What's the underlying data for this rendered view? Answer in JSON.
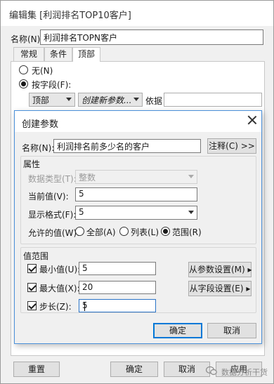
{
  "edit_dialog": {
    "title": "编辑集 [利润排名TOP10客户]",
    "name_label": "名称(N):",
    "name_value": "利润排名TOPN客户",
    "tabs": [
      "常规",
      "条件",
      "顶部"
    ],
    "active_tab": "顶部",
    "radio_none": "无(N)",
    "radio_by_field": "按字段(F):",
    "top_combo": "顶部",
    "param_combo": "创建新参数...",
    "basis_label": "依据",
    "buttons": {
      "reset": "重置",
      "ok": "确定",
      "cancel": "取消",
      "apply": "应用"
    }
  },
  "param_dialog": {
    "title": "创建参数",
    "name_label": "名称(N):",
    "name_value": "利润排名前多少名的客户",
    "comment_button": "注释(C) >>",
    "properties": {
      "group_label": "属性",
      "data_type_label": "数据类型(T):",
      "data_type_value": "整数",
      "current_label": "当前值(V):",
      "current_value": "5",
      "format_label": "显示格式(F):",
      "format_value": "5",
      "allowed_label": "允许的值(W):",
      "allowed_options": [
        "全部(A)",
        "列表(L)",
        "范围(R)"
      ],
      "allowed_selected": "范围(R)"
    },
    "range": {
      "group_label": "值范围",
      "min_label": "最小值(U):",
      "min_value": "5",
      "min_checked": true,
      "max_label": "最大值(X):",
      "max_value": "20",
      "max_checked": true,
      "step_label": "步长(Z):",
      "step_value": "5",
      "step_checked": true,
      "from_param_button": "从参数设置(M) ▸",
      "from_field_button": "从字段设置(E) ▸"
    },
    "buttons": {
      "ok": "确定",
      "cancel": "取消"
    }
  },
  "watermark": {
    "text": "数据分析干货"
  }
}
